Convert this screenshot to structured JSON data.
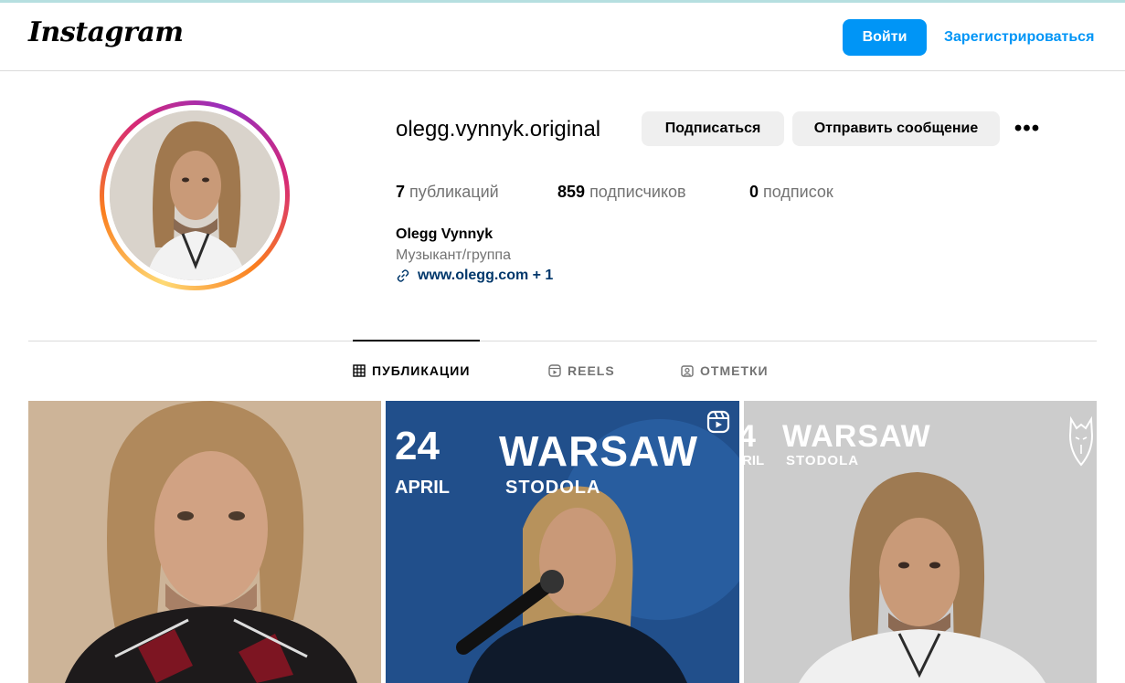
{
  "header": {
    "logo_text": "Instagram",
    "login_label": "Войти",
    "register_label": "Зарегистрироваться"
  },
  "profile": {
    "username": "olegg.vynnyk.original",
    "follow_label": "Подписаться",
    "message_label": "Отправить сообщение",
    "more_label": "•••",
    "stats": {
      "posts_count": "7",
      "posts_label": "публикаций",
      "followers_count": "859",
      "followers_label": "подписчиков",
      "following_count": "0",
      "following_label": "подписок"
    },
    "full_name": "Olegg Vynnyk",
    "category": "Музыкант/группа",
    "website": "www.olegg.com + 1"
  },
  "tabs": [
    {
      "label": "ПУБЛИКАЦИИ",
      "icon": "grid-icon",
      "active": true
    },
    {
      "label": "REELS",
      "icon": "reels-icon",
      "active": false
    },
    {
      "label": "ОТМЕТКИ",
      "icon": "tagged-icon",
      "active": false
    }
  ],
  "posts": [
    {
      "type": "photo"
    },
    {
      "type": "reel",
      "date": "24",
      "month": "APRIL",
      "city": "WARSAW",
      "venue": "STODOLA"
    },
    {
      "type": "photo",
      "date": "4",
      "month": "RIL",
      "city": "WARSAW",
      "venue": "STODOLA"
    }
  ],
  "colors": {
    "brand_blue": "#0095f6",
    "link_dark_blue": "#00376b",
    "secondary_text": "#737373",
    "button_gray": "#efefef"
  }
}
